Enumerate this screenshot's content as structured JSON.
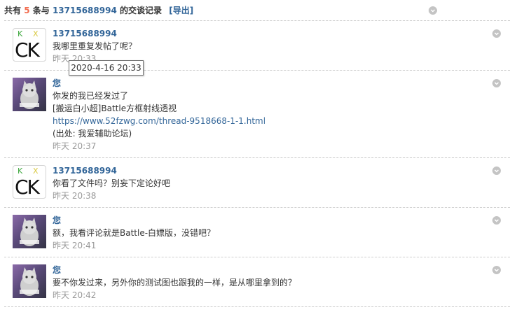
{
  "header": {
    "prefix": "共有",
    "count": "5",
    "mid": "条与",
    "peer": "13715688994",
    "suffix": "的交谈记录",
    "export_label": "[导出]"
  },
  "messages": [
    {
      "avatar": "ck",
      "avatar_text": {
        "k": "K",
        "x": "X",
        "ck": "CK"
      },
      "sender": "13715688994",
      "lines": [
        "我哪里重复发帖了呢？"
      ],
      "time": "昨天 20:33"
    },
    {
      "avatar": "cat",
      "sender": "您",
      "lines": [
        "你发的我已经发过了",
        "[搬运白小超]Battle方框射线透视",
        "https://www.52fzwg.com/thread-9518668-1-1.html",
        "(出处: 我爱辅助论坛)"
      ],
      "time": "昨天 20:37"
    },
    {
      "avatar": "ck",
      "avatar_text": {
        "k": "K",
        "x": "X",
        "ck": "CK"
      },
      "sender": "13715688994",
      "lines": [
        "你看了文件吗？别妄下定论好吧"
      ],
      "time": "昨天 20:38"
    },
    {
      "avatar": "cat",
      "sender": "您",
      "lines": [
        "额，我看评论就是Battle-白嫖版，没错吧？"
      ],
      "time": "昨天 20:41"
    },
    {
      "avatar": "cat",
      "sender": "您",
      "lines": [
        "要不你发过来，另外你的测试图也跟我的一样，是从哪里拿到的？"
      ],
      "time": "昨天 20:42"
    }
  ],
  "tooltip": "2020-4-16 20:33",
  "icons": {
    "delete": "close-circle-icon"
  },
  "colors": {
    "accent": "#336699",
    "count": "#f26c4f",
    "muted": "#999999"
  }
}
